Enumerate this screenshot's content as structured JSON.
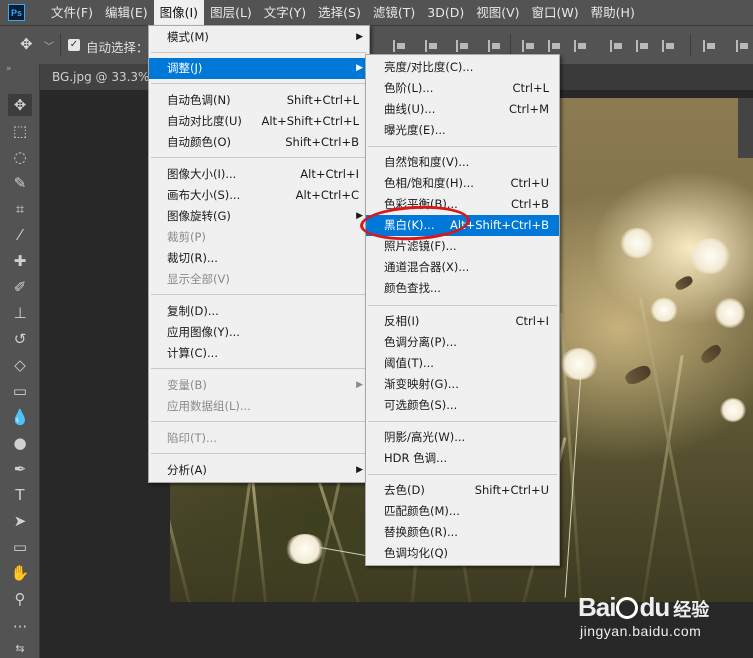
{
  "app": {
    "logo": "Ps",
    "document_tab": "BG.jpg @ 33.3%(R"
  },
  "menubar": {
    "items": [
      "文件(F)",
      "编辑(E)",
      "图像(I)",
      "图层(L)",
      "文字(Y)",
      "选择(S)",
      "滤镜(T)",
      "3D(D)",
      "视图(V)",
      "窗口(W)",
      "帮助(H)"
    ],
    "active_index": 2
  },
  "options_bar": {
    "auto_select_label": "自动选择："
  },
  "image_menu": {
    "items": [
      {
        "label": "模式(M)",
        "shortcut": "",
        "submenu": true,
        "disabled": false
      },
      {
        "label": "调整(J)",
        "shortcut": "",
        "submenu": true,
        "disabled": false,
        "highlighted": true
      },
      {
        "label": "自动色调(N)",
        "shortcut": "Shift+Ctrl+L",
        "disabled": false
      },
      {
        "label": "自动对比度(U)",
        "shortcut": "Alt+Shift+Ctrl+L",
        "disabled": false
      },
      {
        "label": "自动颜色(O)",
        "shortcut": "Shift+Ctrl+B",
        "disabled": false
      },
      {
        "label": "图像大小(I)...",
        "shortcut": "Alt+Ctrl+I",
        "disabled": false
      },
      {
        "label": "画布大小(S)...",
        "shortcut": "Alt+Ctrl+C",
        "disabled": false
      },
      {
        "label": "图像旋转(G)",
        "shortcut": "",
        "submenu": true,
        "disabled": false
      },
      {
        "label": "裁剪(P)",
        "shortcut": "",
        "disabled": true
      },
      {
        "label": "裁切(R)...",
        "shortcut": "",
        "disabled": false
      },
      {
        "label": "显示全部(V)",
        "shortcut": "",
        "disabled": true
      },
      {
        "label": "复制(D)...",
        "shortcut": "",
        "disabled": false
      },
      {
        "label": "应用图像(Y)...",
        "shortcut": "",
        "disabled": false
      },
      {
        "label": "计算(C)...",
        "shortcut": "",
        "disabled": false
      },
      {
        "label": "变量(B)",
        "shortcut": "",
        "submenu": true,
        "disabled": true
      },
      {
        "label": "应用数据组(L)...",
        "shortcut": "",
        "disabled": true
      },
      {
        "label": "陷印(T)...",
        "shortcut": "",
        "disabled": true
      },
      {
        "label": "分析(A)",
        "shortcut": "",
        "submenu": true,
        "disabled": false
      }
    ]
  },
  "adjust_menu": {
    "items": [
      {
        "label": "亮度/对比度(C)...",
        "shortcut": ""
      },
      {
        "label": "色阶(L)...",
        "shortcut": "Ctrl+L"
      },
      {
        "label": "曲线(U)...",
        "shortcut": "Ctrl+M"
      },
      {
        "label": "曝光度(E)...",
        "shortcut": ""
      },
      {
        "label": "自然饱和度(V)...",
        "shortcut": ""
      },
      {
        "label": "色相/饱和度(H)...",
        "shortcut": "Ctrl+U"
      },
      {
        "label": "色彩平衡(B)...",
        "shortcut": "Ctrl+B"
      },
      {
        "label": "黑白(K)...",
        "shortcut": "Alt+Shift+Ctrl+B",
        "highlighted": true
      },
      {
        "label": "照片滤镜(F)...",
        "shortcut": ""
      },
      {
        "label": "通道混合器(X)...",
        "shortcut": ""
      },
      {
        "label": "颜色查找...",
        "shortcut": ""
      },
      {
        "label": "反相(I)",
        "shortcut": "Ctrl+I"
      },
      {
        "label": "色调分离(P)...",
        "shortcut": ""
      },
      {
        "label": "阈值(T)...",
        "shortcut": ""
      },
      {
        "label": "渐变映射(G)...",
        "shortcut": ""
      },
      {
        "label": "可选颜色(S)...",
        "shortcut": ""
      },
      {
        "label": "阴影/高光(W)...",
        "shortcut": ""
      },
      {
        "label": "HDR 色调...",
        "shortcut": ""
      },
      {
        "label": "去色(D)",
        "shortcut": "Shift+Ctrl+U"
      },
      {
        "label": "匹配颜色(M)...",
        "shortcut": ""
      },
      {
        "label": "替换颜色(R)...",
        "shortcut": ""
      },
      {
        "label": "色调均化(Q)",
        "shortcut": ""
      }
    ]
  },
  "watermark": {
    "logo_a": "Bai",
    "logo_b": "du",
    "brand": "经验",
    "url": "jingyan.baidu.com"
  },
  "colors": {
    "menu_highlight": "#0078d7",
    "annotation_circle": "#d8191c",
    "ui_panel": "#535353"
  }
}
